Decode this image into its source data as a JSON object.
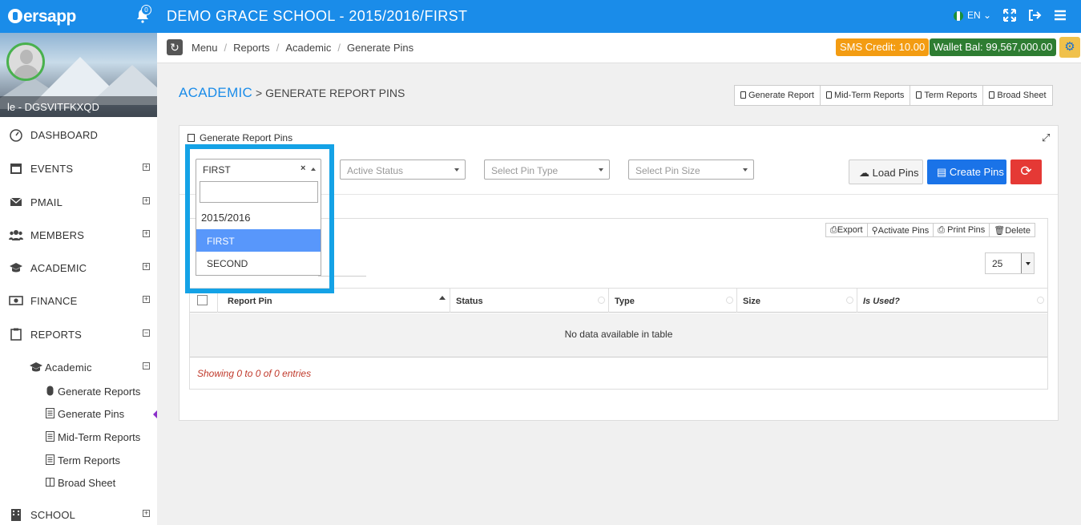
{
  "topbar": {
    "logo_text": "ersapp",
    "notification_count": "0",
    "school_title": "DEMO GRACE SCHOOL - 2015/2016/FIRST",
    "language": "EN"
  },
  "sidebar": {
    "profile_name": "le - DGSVITFKXQD",
    "items": [
      {
        "label": "DASHBOARD"
      },
      {
        "label": "EVENTS"
      },
      {
        "label": "PMAIL"
      },
      {
        "label": "MEMBERS"
      },
      {
        "label": "ACADEMIC"
      },
      {
        "label": "FINANCE"
      },
      {
        "label": "REPORTS"
      },
      {
        "label": "SCHOOL"
      }
    ],
    "academic_group": "Academic",
    "sub_items": [
      {
        "label": "Generate Reports"
      },
      {
        "label": "Generate Pins"
      },
      {
        "label": "Mid-Term Reports"
      },
      {
        "label": "Term Reports"
      },
      {
        "label": "Broad Sheet"
      }
    ]
  },
  "breadcrumb": {
    "items": [
      "Menu",
      "Reports",
      "Academic",
      "Generate Pins"
    ]
  },
  "account": {
    "sms_credit": "SMS Credit: 10.00",
    "wallet": "Wallet Bal: 99,567,000.00"
  },
  "page": {
    "heading_section": "ACADEMIC",
    "heading_rest": "> GENERATE REPORT PINS",
    "top_buttons": [
      "Generate Report",
      "Mid-Term Reports",
      "Term Reports",
      "Broad Sheet"
    ]
  },
  "panel": {
    "title": "Generate Report Pins",
    "term_select": "FIRST",
    "status_placeholder": "Active Status",
    "type_placeholder": "Select Pin Type",
    "size_placeholder": "Select Pin Size",
    "load_button": "Load Pins",
    "create_button": "Create Pins"
  },
  "dropdown": {
    "group_label": "2015/2016",
    "options": [
      "FIRST",
      "SECOND"
    ],
    "selected": "FIRST"
  },
  "table": {
    "tools": [
      "Export",
      "Activate Pins",
      "Print Pins",
      "Delete"
    ],
    "page_length": "25",
    "columns": [
      "Report Pin",
      "Status",
      "Type",
      "Size",
      "Is Used?"
    ],
    "empty_message": "No data available in table",
    "info": "Showing 0 to 0 of 0 entries"
  },
  "colors": {
    "topbar": "#1a8ce9",
    "sms_badge": "#f39c12",
    "wallet_badge": "#2e7d32",
    "create_button": "#1a73e8",
    "reset_button": "#e53935",
    "highlight": "#14a2e6",
    "selected_option": "#5897fb"
  }
}
